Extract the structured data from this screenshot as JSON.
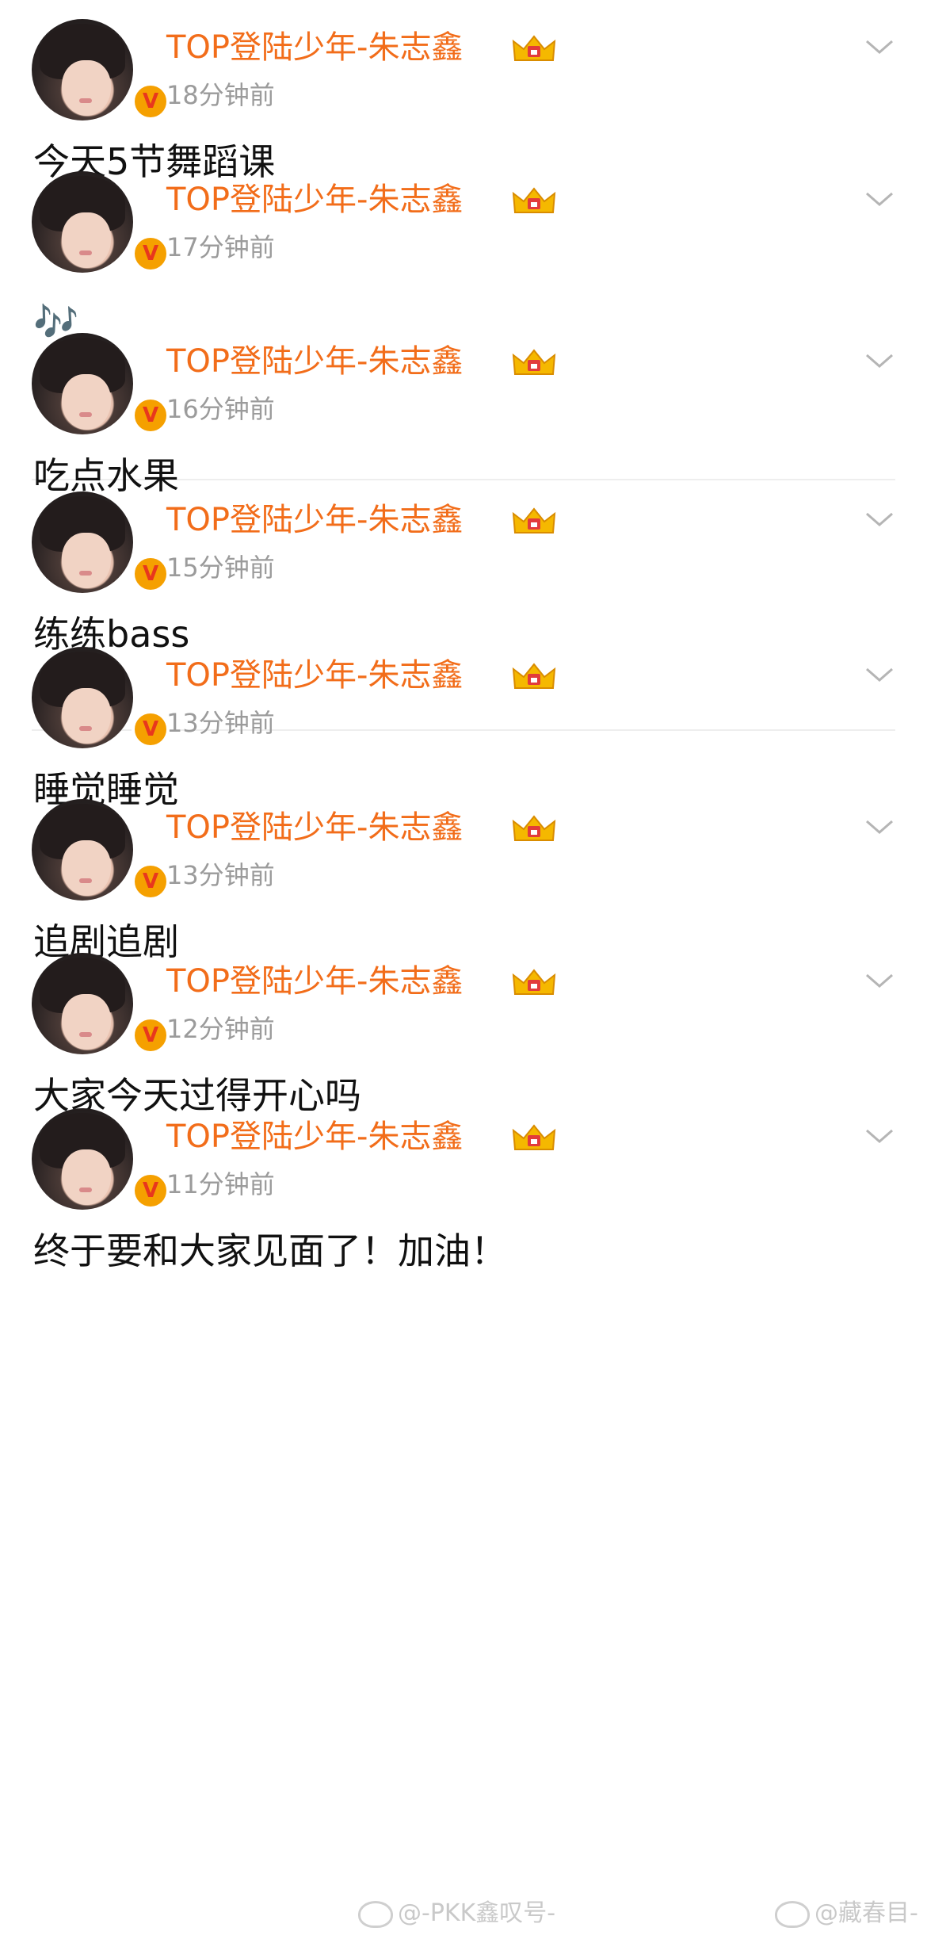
{
  "user": {
    "name": "TOP登陆少年-朱志鑫",
    "verified_badge": "V"
  },
  "posts": [
    {
      "time": "18分钟前",
      "content": "今天5节舞蹈课"
    },
    {
      "time": "17分钟前",
      "content": "🎶"
    },
    {
      "time": "16分钟前",
      "content": "吃点水果"
    },
    {
      "time": "15分钟前",
      "content": "练练bass"
    },
    {
      "time": "13分钟前",
      "content": "睡觉睡觉"
    },
    {
      "time": "13分钟前",
      "content": "追剧追剧"
    },
    {
      "time": "12分钟前",
      "content": "大家今天过得开心吗"
    },
    {
      "time": "11分钟前",
      "content": "终于要和大家见面了！加油！"
    }
  ],
  "watermarks": [
    "@-PKK鑫叹号-",
    "@藏春目-"
  ],
  "colors": {
    "name": "#f26d1a",
    "time": "#9b9b9b",
    "badge": "#f5a000"
  }
}
